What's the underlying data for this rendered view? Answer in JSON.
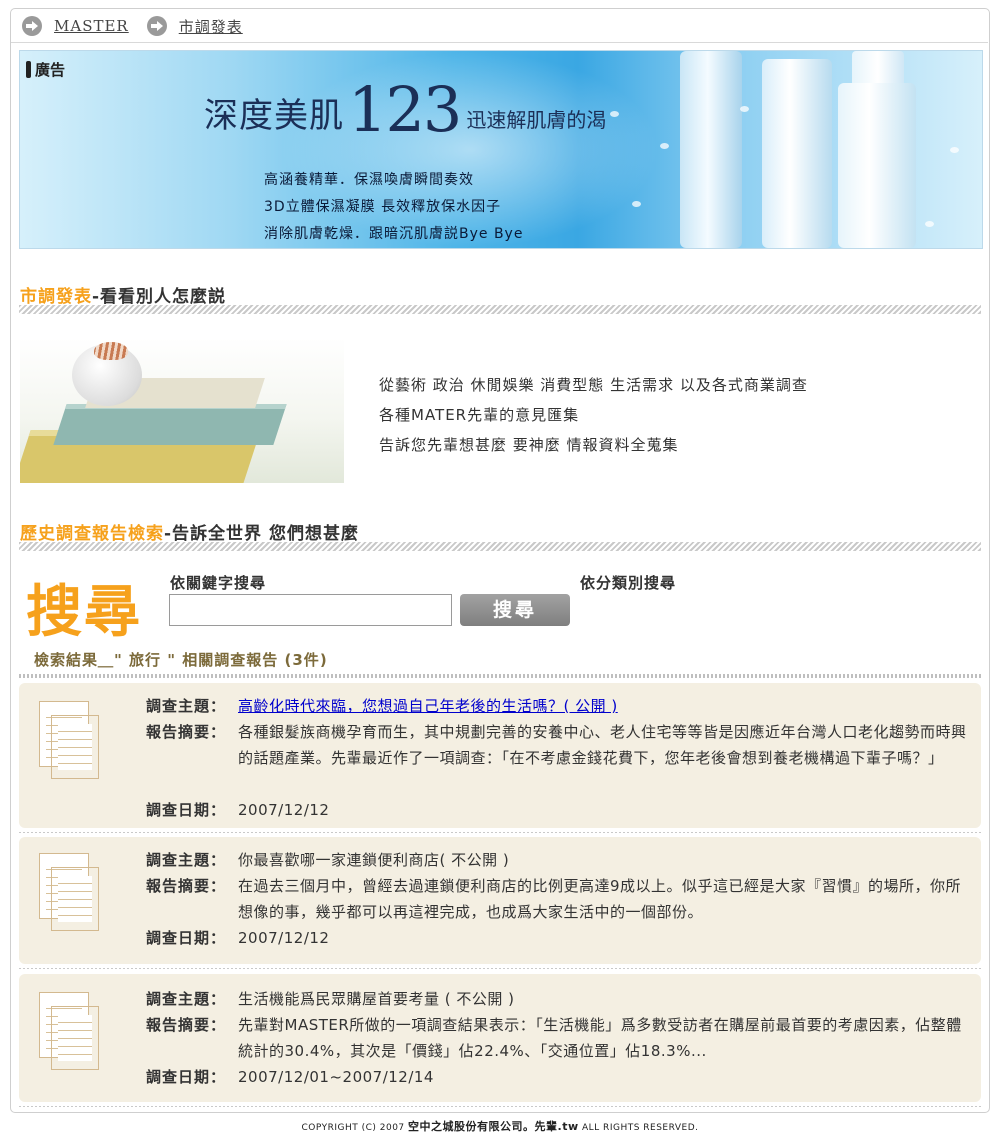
{
  "breadcrumb": {
    "home": "MASTER",
    "current": "市調發表"
  },
  "ad": {
    "tag": "廣告",
    "headline_a": "深度美肌",
    "headline_num": "123",
    "headline_b": "迅速解肌膚的渴",
    "lines": [
      "高涵養精華．保濕喚膚瞬間奏效",
      "3D立體保濕凝膜  長效釋放保水因子",
      "消除肌膚乾燥．跟暗沉肌膚説Bye  Bye"
    ],
    "colors": {
      "sky": "#3aa7e3",
      "text": "#1b2f57"
    }
  },
  "section1": {
    "highlight": "市調發表",
    "rest": "-看看別人怎麼説"
  },
  "intro": {
    "lines": [
      "從藝術 政治 休閒娛樂 消費型態 生活需求  以及各式商業調查",
      "各種MATER先輩的意見匯集",
      "告訴您先輩想甚麼 要神麼 情報資料全蒐集"
    ]
  },
  "section2": {
    "highlight": "歷史調查報告檢索",
    "rest": "-告訴全世界  您們想甚麼"
  },
  "search": {
    "big_label": "搜尋",
    "keyword_label": "依關鍵字搜尋",
    "category_label": "依分類別搜尋",
    "keyword_value": "",
    "button": "搜尋"
  },
  "results": {
    "title": "檢索結果＿\" 旅行 \" 相關調查報告 (3件)",
    "labels": {
      "topic": "調查主題：",
      "summary": "報告摘要：",
      "date": "調查日期："
    },
    "items": [
      {
        "topic": "高齡化時代來臨，您想過自己年老後的生活嗎？( 公開 )",
        "summary": "各種銀髮族商機孕育而生，其中規劃完善的安養中心、老人住宅等等皆是因應近年台灣人口老化趨勢而時興的話題產業。先輩最近作了一項調查：「在不考慮金錢花費下，您年老後會想到養老機構過下輩子嗎？」",
        "date": "2007/12/12"
      },
      {
        "topic": "你最喜歡哪一家連鎖便利商店( 不公開 )",
        "summary": "在過去三個月中，曾經去過連鎖便利商店的比例更高達9成以上。似乎這已經是大家『習慣』的場所，你所想像的事，幾乎都可以再這裡完成，也成爲大家生活中的一個部份。",
        "date": "2007/12/12"
      },
      {
        "topic": "生活機能爲民眾購屋首要考量 ( 不公開 )",
        "summary": "先輩對MASTER所做的一項調查結果表示：「生活機能」爲多數受訪者在購屋前最首要的考慮因素，佔整體統計的30.4%，其次是「價錢」佔22.4%、「交通位置」佔18.3%...",
        "date": "2007/12/01~2007/12/14"
      }
    ]
  },
  "footer": {
    "prefix": "COPYRIGHT (C) 2007",
    "company": "空中之城股份有限公司。先輩.tw",
    "suffix": "ALL RIGHTS RESERVED."
  },
  "colors": {
    "accent": "#f6a11c",
    "card_bg": "#f4efe2",
    "result_title": "#7c6a3a",
    "link": "#0000cc"
  },
  "icons": {
    "breadcrumb_arrow": "arrow-circle-right-icon",
    "report": "document-icon"
  }
}
